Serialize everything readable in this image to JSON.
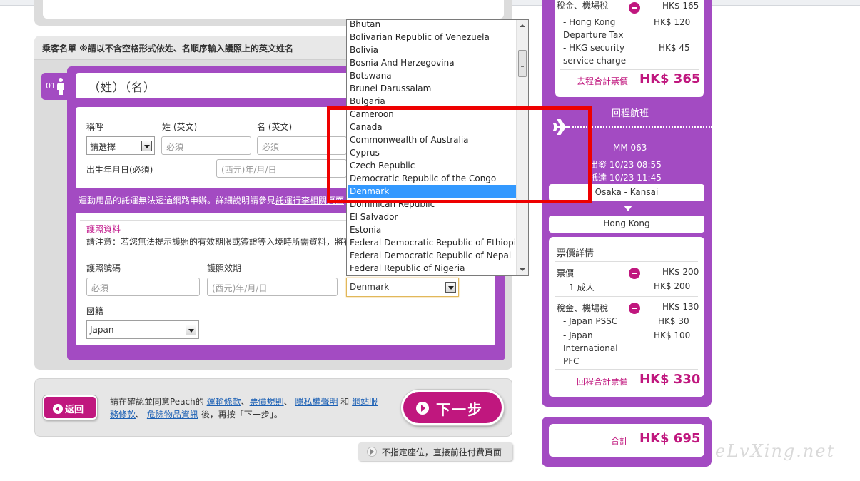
{
  "passenger_list": {
    "header": "乘客名單 ※請以不含空格形式依姓、名順序輸入護照上的英文姓名",
    "passenger_number": "01",
    "name_bar": "（姓）（名）",
    "salutation": {
      "label": "稱呼",
      "value": "請選擇"
    },
    "surname": {
      "label": "姓 (英文)",
      "placeholder": "必須"
    },
    "given_name": {
      "label": "名 (英文)",
      "placeholder": "必須"
    },
    "birthdate": {
      "label": "出生年月日(必須)",
      "placeholder": "(西元)年/月/日"
    },
    "notice_prefix": "運動用品的託運無法透過網路申辦。詳細說明請參見",
    "notice_link": "託運行李相關頁面",
    "passport": {
      "section_title": "護照資料",
      "note": "請注意：若您無法提示護照的有效期限或簽證等入境時所需資料，將有",
      "number_label": "護照號碼",
      "number_placeholder": "必須",
      "expiry_label": "護照效期",
      "expiry_placeholder": "(西元)年/月/日",
      "issuing_country_value": "Denmark",
      "nationality_label": "國籍",
      "nationality_value": "Japan"
    }
  },
  "country_dropdown": {
    "options": [
      "Bhutan",
      "Bolivarian Republic of Venezuela",
      "Bolivia",
      "Bosnia And Herzegovina",
      "Botswana",
      "Brunei Darussalam",
      "Bulgaria",
      "Cameroon",
      "Canada",
      "Commonwealth of Australia",
      "Cyprus",
      "Czech Republic",
      "Democratic Republic of the Congo",
      "Denmark",
      "Dominican Republic",
      "El Salvador",
      "Estonia",
      "Federal Democratic Republic of Ethiopia",
      "Federal Democratic Republic of Nepal",
      "Federal Republic of Nigeria"
    ],
    "selected": "Denmark",
    "highlight_color": "#3399ff"
  },
  "footer": {
    "back_label": "返回",
    "text_prefix": "請在確認並同意Peach的",
    "link_transport": "運輸條款",
    "link_fare_rules": "票價規則",
    "link_privacy": "隱私權聲明",
    "conj": "和",
    "link_site_terms": "網站服務條款",
    "link_dangerous_goods": "危險物品資訊",
    "text_suffix": "後，再按「下一步」。",
    "next_label": "下一步",
    "skip_label": "不指定座位，直接前往付費頁面"
  },
  "summary": {
    "outbound": {
      "tax_header": "稅金、機場稅",
      "tax_header_amount": "HK$ 165",
      "items": [
        {
          "label": "- Hong Kong Departure Tax",
          "amount": "HK$ 120"
        },
        {
          "label": "- HKG security service charge",
          "amount": "HK$ 45"
        }
      ],
      "total_label": "去程合計票價",
      "total_amount": "HK$ 365"
    },
    "return": {
      "title": "回程航班",
      "flight": "MM  063",
      "depart_label": "出發",
      "depart_time": "10/23  08:55",
      "arrive_label": "抵達",
      "arrive_time": "10/23  11:45",
      "origin": "Osaka - Kansai",
      "destination": "Hong Kong",
      "fare_details_title": "票價詳情",
      "fare_label": "票價",
      "fare_amount": "HK$ 200",
      "fare_item_label": "- 1    成人",
      "fare_item_amount": "HK$ 200",
      "tax_label": "稅金、機場稅",
      "tax_amount": "HK$ 130",
      "tax_items": [
        {
          "label": "- Japan PSSC",
          "amount": "HK$ 30"
        },
        {
          "label": "- Japan International PFC",
          "amount": "HK$ 100"
        }
      ],
      "total_label": "回程合計票價",
      "total_amount": "HK$ 330"
    },
    "grand_total_label": "合計",
    "grand_total_amount": "HK$ 695"
  },
  "watermark": "eLvXing.net",
  "colors": {
    "purple": "#a34bc2",
    "magenta": "#c0177e",
    "annotation_red": "#ee0000"
  }
}
